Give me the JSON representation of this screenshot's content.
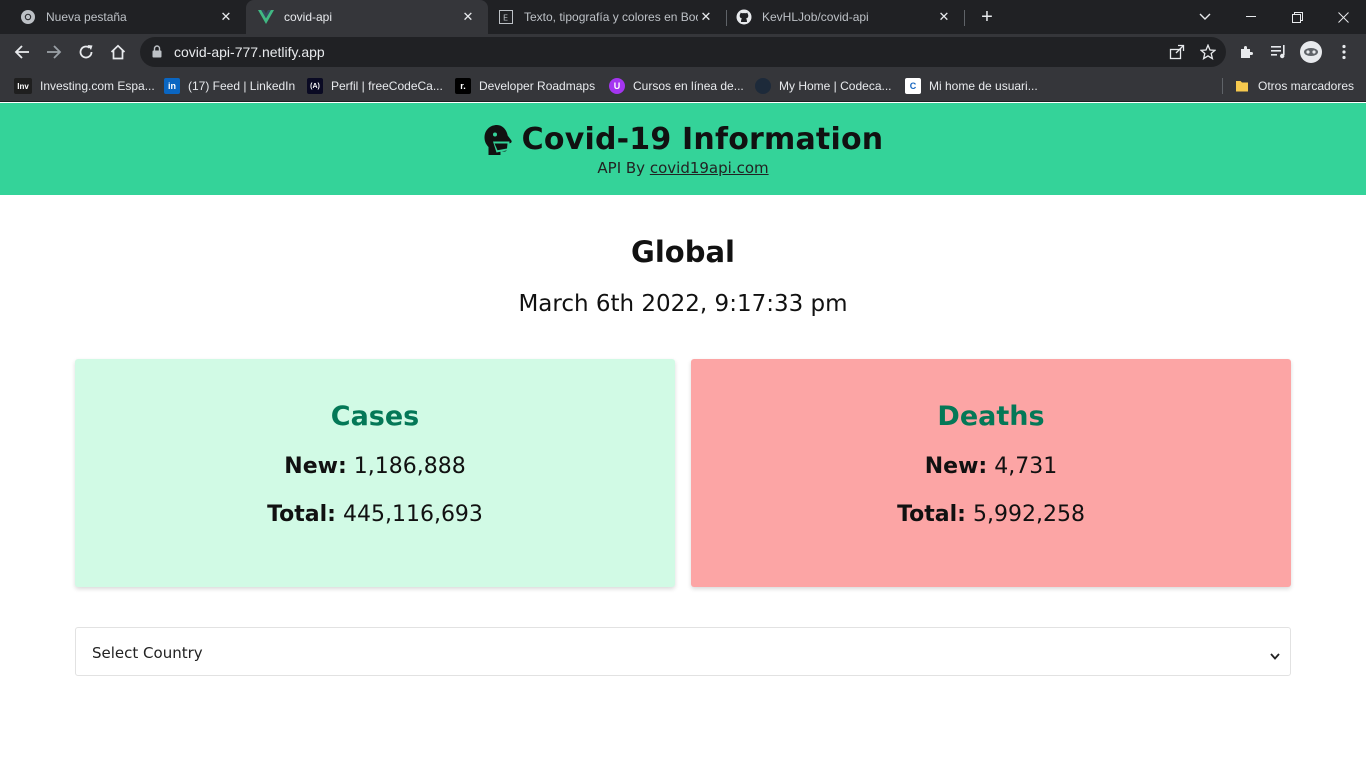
{
  "browser": {
    "tabs": [
      {
        "title": "Nueva pestaña",
        "icon": "chrome-icon"
      },
      {
        "title": "covid-api",
        "icon": "vue-icon",
        "active": true
      },
      {
        "title": "Texto, tipografía y colores en Boo",
        "icon": "page-icon"
      },
      {
        "title": "KevHLJob/covid-api",
        "icon": "github-icon"
      }
    ],
    "url": "covid-api-777.netlify.app",
    "bookmarks": [
      {
        "label": "Investing.com Espa...",
        "icon_text": "Inv"
      },
      {
        "label": "(17) Feed | LinkedIn",
        "icon_text": "in"
      },
      {
        "label": "Perfil | freeCodeCa...",
        "icon_text": "(A)"
      },
      {
        "label": "Developer Roadmaps",
        "icon_text": "r."
      },
      {
        "label": "Cursos en línea de...",
        "icon_text": "U"
      },
      {
        "label": "My Home | Codeca...",
        "icon_text": ""
      },
      {
        "label": "Mi home de usuari...",
        "icon_text": "C"
      }
    ],
    "other_bookmarks": "Otros marcadores"
  },
  "header": {
    "title": "Covid-19 Information",
    "subtitle_prefix": "API By",
    "subtitle_link": "covid19api.com"
  },
  "global": {
    "title": "Global",
    "date": "March 6th 2022, 9:17:33 pm"
  },
  "cases": {
    "title": "Cases",
    "new_label": "New:",
    "new_value": "1,186,888",
    "total_label": "Total:",
    "total_value": "445,116,693"
  },
  "deaths": {
    "title": "Deaths",
    "new_label": "New:",
    "new_value": "4,731",
    "total_label": "Total:",
    "total_value": "5,992,258"
  },
  "country_select": {
    "selected": "Select Country"
  },
  "colors": {
    "header_bg": "#34d399",
    "cases_bg": "#d1fae5",
    "deaths_bg": "#fca5a5",
    "card_title": "#047857"
  }
}
